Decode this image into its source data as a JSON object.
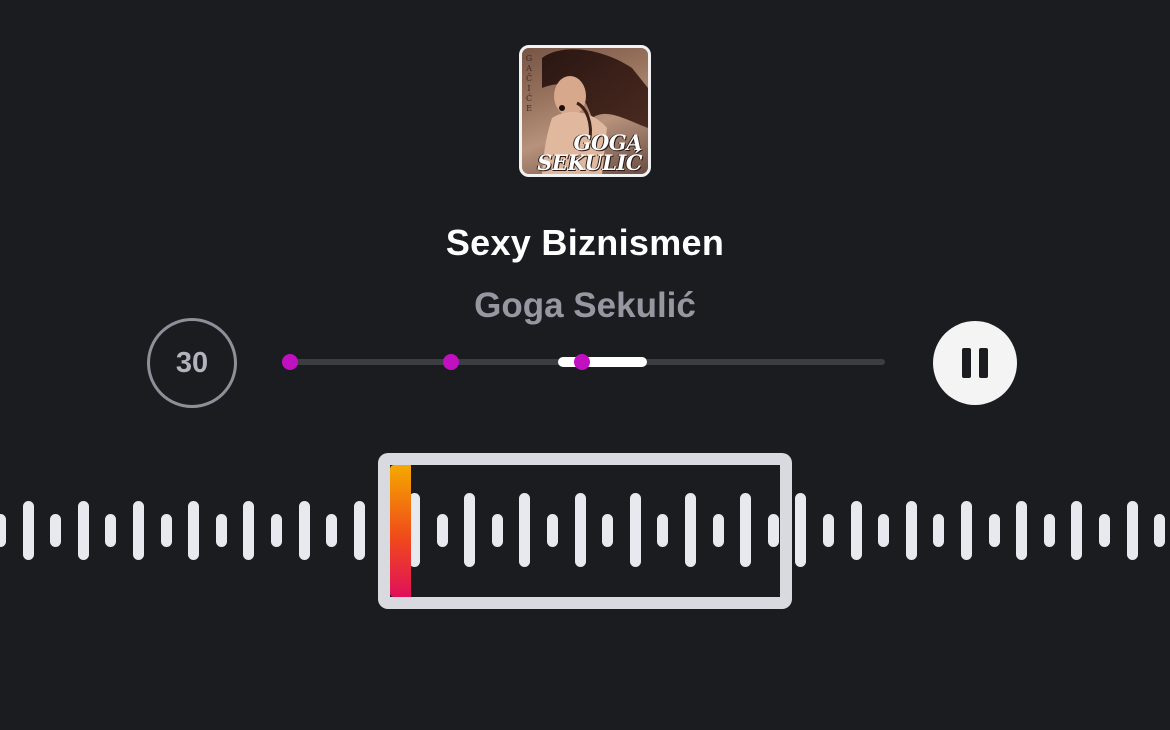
{
  "track": {
    "title": "Sexy Biznismen",
    "artist": "Goga Sekulić"
  },
  "album_art": {
    "first_name": "GOGA",
    "last_name": "SEKULIĆ",
    "side_text": "GAČIĆE"
  },
  "controls": {
    "skip_label": "30",
    "pause_icon": "pause-icon",
    "skip_icon": "circle-30"
  },
  "seek": {
    "window_start_fraction": 0.45,
    "window_end_fraction": 0.6,
    "marker_fractions": [
      0.0,
      0.27,
      0.49
    ]
  },
  "waveform": {
    "bar_levels": [
      0.45,
      0.8,
      0.45,
      0.8,
      0.45,
      0.8,
      0.45,
      0.8,
      0.45,
      0.8,
      0.45,
      0.8,
      0.45,
      0.8,
      0.45,
      1.0,
      0.45,
      1.0,
      0.45,
      1.0,
      0.45,
      1.0,
      0.45,
      1.0,
      0.45,
      1.0,
      0.45,
      1.0,
      0.45,
      1.0,
      0.45,
      0.8,
      0.45,
      0.8,
      0.45,
      0.8,
      0.45,
      0.8,
      0.45,
      0.8,
      0.45,
      0.8,
      0.45
    ],
    "selection_start_bar": 14,
    "selection_end_bar": 28
  },
  "colors": {
    "background": "#1b1c20",
    "marker": "#c010c0",
    "playhead_top": "#f5a900",
    "playhead_bottom": "#e0105a"
  }
}
